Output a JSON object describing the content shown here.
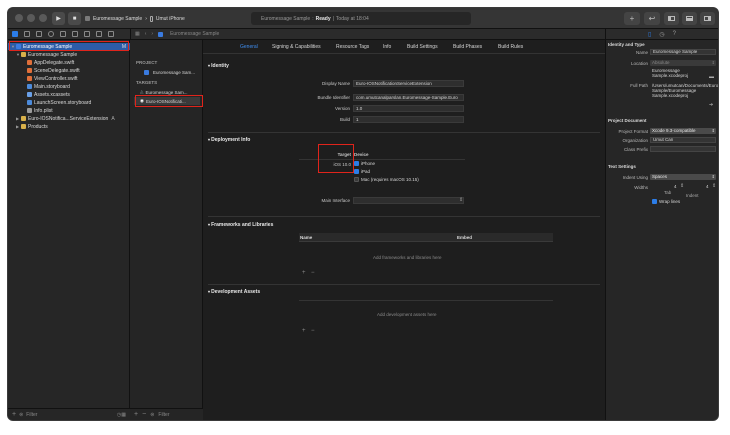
{
  "colors": {
    "accent": "#2c7de8",
    "highlight": "#e0241b",
    "selection": "#2c5ca8",
    "background": "#1e1e1e"
  },
  "toolbar": {
    "run_icon": "play-icon",
    "stop_icon": "stop-icon",
    "scheme": "Euromessage Sample",
    "destination": "Umut iPhone",
    "activity_project": "Euromessage Sample",
    "activity_status": "Ready",
    "activity_time": "Today at 18:04",
    "library_label": "+",
    "review_label": "↩"
  },
  "jumpbar": {
    "project": "Euromessage Sample"
  },
  "navigator": {
    "items": [
      {
        "label": "Euromessage Sample",
        "indent": 0,
        "icon": "proj",
        "disclosure": "▼",
        "selected": true,
        "badge": "M"
      },
      {
        "label": "Euromessage Sample",
        "indent": 1,
        "icon": "folder",
        "disclosure": "▼"
      },
      {
        "label": "AppDelegate.swift",
        "indent": 2,
        "icon": "swift"
      },
      {
        "label": "SceneDelegate.swift",
        "indent": 2,
        "icon": "swift"
      },
      {
        "label": "ViewController.swift",
        "indent": 2,
        "icon": "swift"
      },
      {
        "label": "Main.storyboard",
        "indent": 2,
        "icon": "sb"
      },
      {
        "label": "Assets.xcassets",
        "indent": 2,
        "icon": "assets"
      },
      {
        "label": "LaunchScreen.storyboard",
        "indent": 2,
        "icon": "sb"
      },
      {
        "label": "Info.plist",
        "indent": 2,
        "icon": "plist"
      },
      {
        "label": "Euro-IOSNotifica...ServiceExtension",
        "indent": 1,
        "icon": "folder",
        "disclosure": "▶",
        "badge": "A"
      },
      {
        "label": "Products",
        "indent": 1,
        "icon": "folder",
        "disclosure": "▶"
      }
    ],
    "filter_placeholder": "Filter"
  },
  "project_list": {
    "project_header": "PROJECT",
    "project_item": "Euromessage Sam...",
    "targets_header": "TARGETS",
    "targets": [
      "Euromessage Sam...",
      "Euro-IOSNotificati..."
    ],
    "filter_placeholder": "Filter",
    "add_label": "+",
    "remove_label": "−"
  },
  "editor": {
    "tabs": [
      "General",
      "Signing & Capabilities",
      "Resource Tags",
      "Info",
      "Build Settings",
      "Build Phases",
      "Build Rules"
    ],
    "identity": {
      "title": "Identity",
      "display_name_label": "Display Name",
      "display_name": "Euro-IOSNotificationServiceExtension",
      "bundle_id_label": "Bundle Identifier",
      "bundle_id": "com.umutcanalparslan.Euromessage-Sample.Euro",
      "version_label": "Version",
      "version": "1.0",
      "build_label": "Build",
      "build": "1"
    },
    "deployment": {
      "title": "Deployment Info",
      "target_label": "Target",
      "target_value": "iOS 10.0",
      "device_label": "Device",
      "devices": [
        {
          "label": "iPhone",
          "checked": true
        },
        {
          "label": "iPad",
          "checked": true
        },
        {
          "label": "Mac  (requires macOS 10.15)",
          "checked": false
        }
      ],
      "main_interface_label": "Main Interface",
      "main_interface_value": ""
    },
    "frameworks": {
      "title": "Frameworks and Libraries",
      "col_name": "Name",
      "col_embed": "Embed",
      "empty": "Add frameworks and libraries here",
      "add_label": "+",
      "remove_label": "−"
    },
    "assets": {
      "title": "Development Assets",
      "empty": "Add development assets here",
      "add_label": "+",
      "remove_label": "−"
    }
  },
  "inspector": {
    "identity_title": "Identity and Type",
    "name_label": "Name",
    "name_value": "Euromessage Sample",
    "location_label": "Location",
    "location_value": "Absolute",
    "location_file": "Euromessage Sample.xcodeproj",
    "fullpath_label": "Full Path",
    "fullpath_value": "/Users/umutcan/Documents/Euromessage Sample/Euromessage Sample.xcodeproj",
    "project_doc_title": "Project Document",
    "format_label": "Project Format",
    "format_value": "Xcode 9.3-compatible",
    "org_label": "Organization",
    "org_value": "Umut Can",
    "prefix_label": "Class Prefix",
    "prefix_value": "",
    "text_title": "Text Settings",
    "indent_label": "Indent Using",
    "indent_value": "Spaces",
    "widths_label": "Widths",
    "tab_width": "4",
    "indent_width": "4",
    "tab_label": "Tab",
    "indent_sub_label": "Indent",
    "wrap_label": "Wrap lines"
  }
}
